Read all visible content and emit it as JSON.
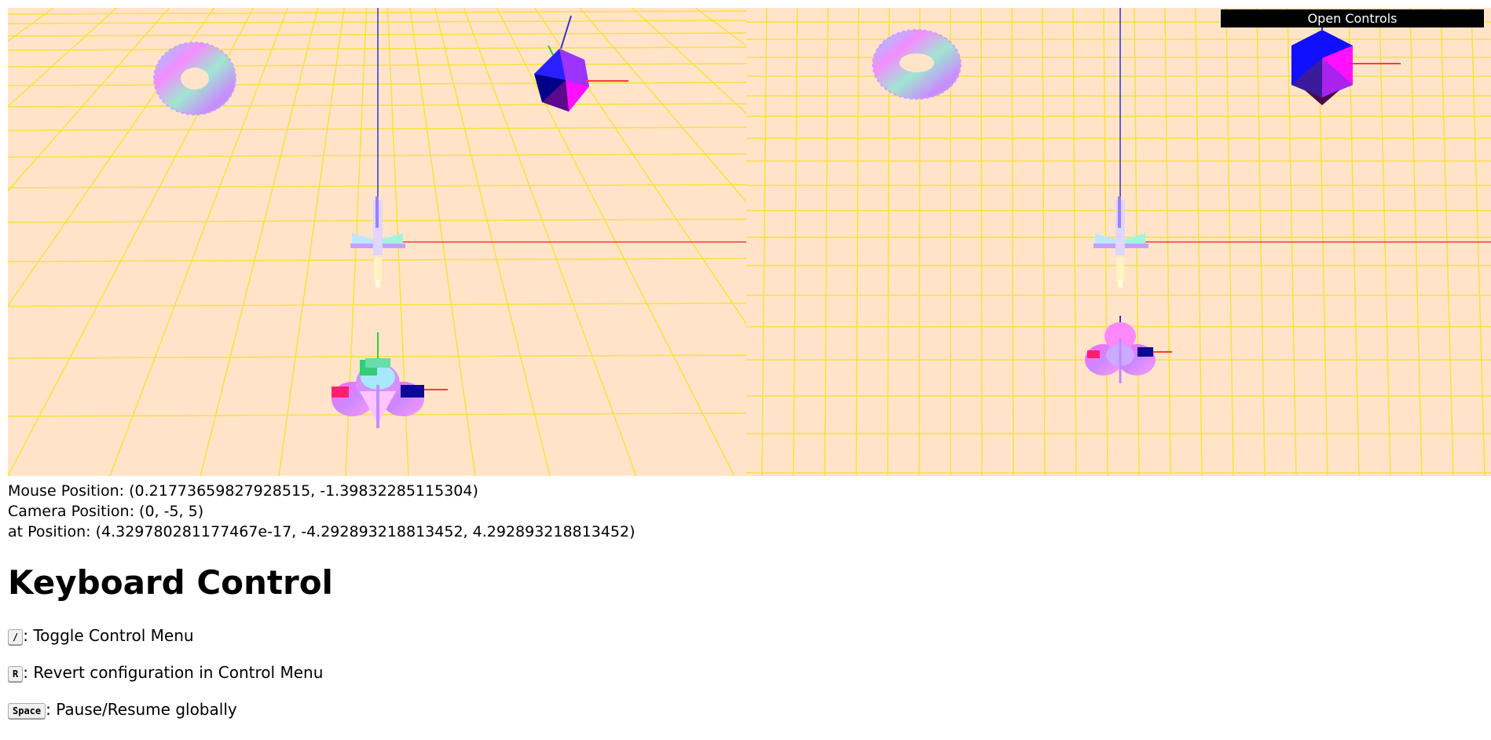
{
  "controls_button": "Open Controls",
  "info": {
    "mouse_label": "Mouse Position: ",
    "mouse_value": "(0.21773659827928515, -1.39832285115304)",
    "camera_label": "Camera Position: ",
    "camera_value": "(0, -5, 5)",
    "at_label": "at Position: ",
    "at_value": "(4.329780281177467e-17, -4.292893218813452, 4.292893218813452)"
  },
  "keyboard": {
    "title": "Keyboard Control",
    "items": [
      {
        "key": "/",
        "description": ": Toggle Control Menu"
      },
      {
        "key": "R",
        "description": ": Revert configuration in Control Menu"
      },
      {
        "key": "Space",
        "description": ": Pause/Resume globally"
      }
    ]
  },
  "colors": {
    "floor": "#ffe4c9",
    "grid": "#f7e23a",
    "x_axis": "#ff3b3b",
    "y_axis": "#33cc33",
    "z_axis": "#3333cc"
  },
  "icons": {
    "scene_objects": [
      "torus",
      "icosahedron",
      "axes-helper",
      "lamp-model",
      "flower-model"
    ]
  }
}
